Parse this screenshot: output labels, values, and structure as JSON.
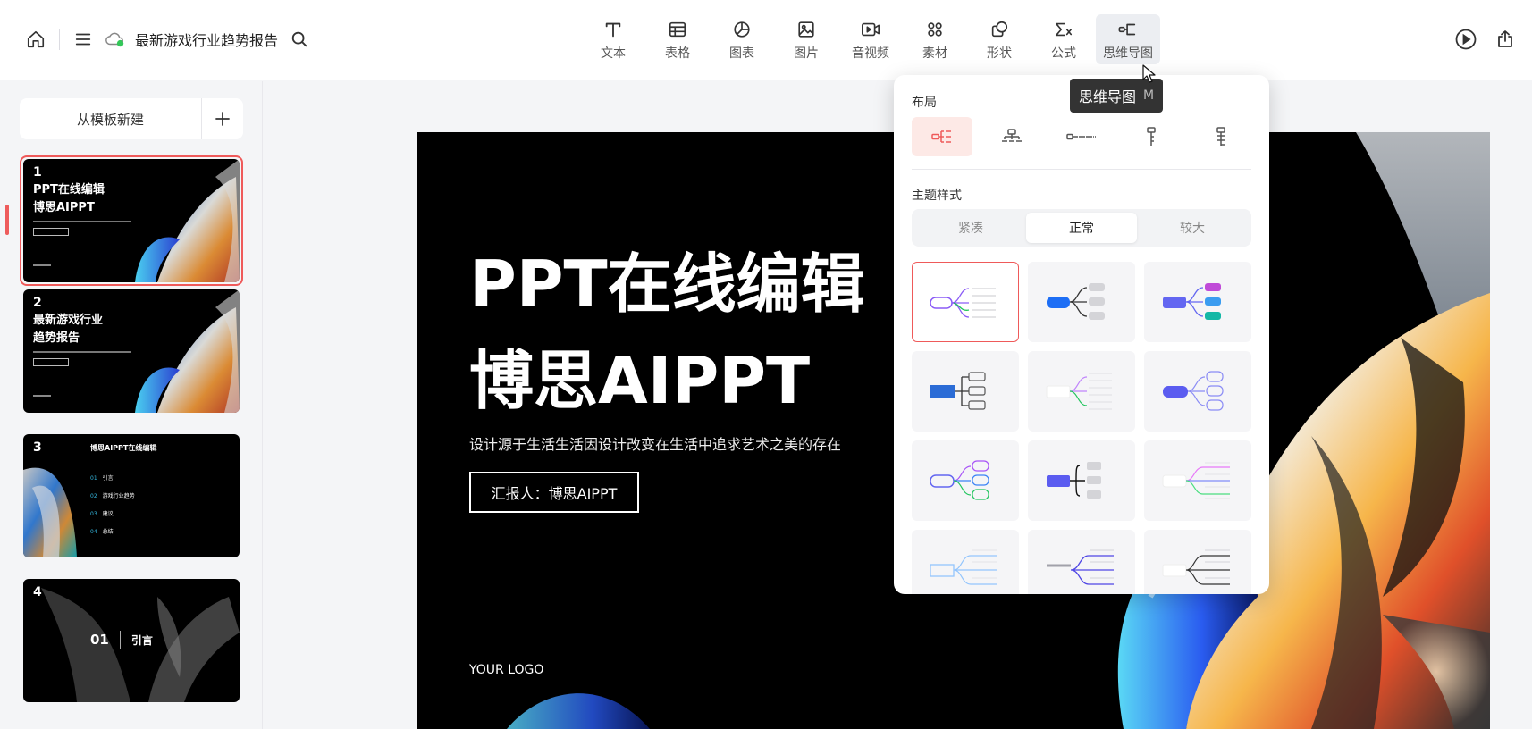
{
  "app": {
    "doc_title": "最新游戏行业趋势报告"
  },
  "toolbar": {
    "tools": [
      {
        "label": "文本",
        "icon": "text-icon"
      },
      {
        "label": "表格",
        "icon": "table-icon"
      },
      {
        "label": "图表",
        "icon": "pie-chart-icon"
      },
      {
        "label": "图片",
        "icon": "image-icon"
      },
      {
        "label": "音视频",
        "icon": "video-icon"
      },
      {
        "label": "素材",
        "icon": "assets-icon"
      },
      {
        "label": "形状",
        "icon": "shape-icon"
      },
      {
        "label": "公式",
        "icon": "formula-icon"
      },
      {
        "label": "思维导图",
        "icon": "mindmap-icon"
      }
    ],
    "active_tool": "思维导图"
  },
  "tooltip": {
    "label": "思维导图",
    "shortcut": "M"
  },
  "sidebar": {
    "new_from_template": "从模板新建",
    "slides": [
      {
        "num": "1",
        "title_line1": "PPT在线编辑",
        "title_line2": "博思AIPPT"
      },
      {
        "num": "2",
        "title_line1": "最新游戏行业",
        "title_line2": "趋势报告"
      },
      {
        "num": "3",
        "title": "博思AIPPT在线编辑",
        "items": [
          {
            "n": "01",
            "t": "引言"
          },
          {
            "n": "02",
            "t": "游戏行业趋势"
          },
          {
            "n": "03",
            "t": "建议"
          },
          {
            "n": "04",
            "t": "总结"
          }
        ]
      },
      {
        "num": "4",
        "section_num": "01",
        "section_label": "引言"
      }
    ]
  },
  "slide": {
    "title_line1": "PPT在线编辑",
    "title_line2": "博思AIPPT",
    "subtitle": "设计源于生活生活因设计改变在生活中追求艺术之美的存在",
    "presenter_button": "汇报人：博思AIPPT",
    "logo": "YOUR LOGO"
  },
  "mindmap_panel": {
    "layout_heading": "布局",
    "theme_heading": "主题样式",
    "size_options": [
      "紧凑",
      "正常",
      "较大"
    ],
    "selected_size": "正常",
    "selected_layout": 0,
    "selected_theme": 0
  },
  "colors": {
    "accent": "#ef5a5a",
    "active_green": "#34c759"
  }
}
